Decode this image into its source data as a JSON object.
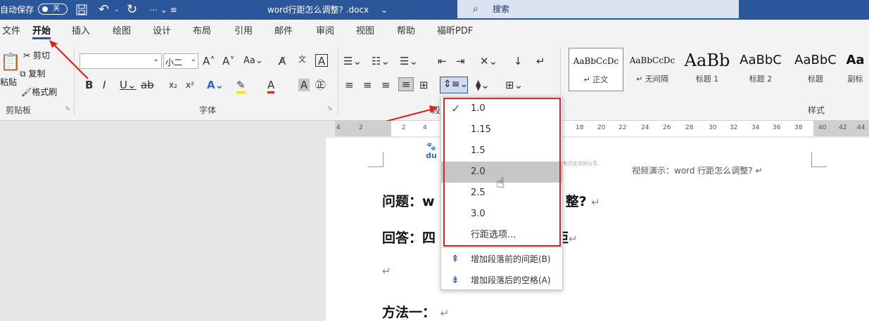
{
  "titlebar": {
    "autosave": "自动保存",
    "toggle": "关",
    "qat_icons": [
      "save-icon",
      "undo-icon",
      "redo-icon",
      "customize-icon"
    ],
    "doc_title": "word行距怎么调整? .docx",
    "search_placeholder": "搜索"
  },
  "tabs": [
    "文件",
    "开始",
    "插入",
    "绘图",
    "设计",
    "布局",
    "引用",
    "邮件",
    "审阅",
    "视图",
    "帮助",
    "福昕PDF"
  ],
  "ribbon": {
    "clipboard": {
      "paste": "粘贴",
      "cut": "剪切",
      "copy": "复制",
      "format_painter": "格式刷",
      "group": "剪贴板"
    },
    "font": {
      "font_name": "",
      "font_size": "小二",
      "group": "字体"
    },
    "paragraph": {
      "group": "段落"
    },
    "styles": {
      "group": "样式",
      "items": [
        {
          "preview": "AaBbCcDc",
          "name": "↵ 正文"
        },
        {
          "preview": "AaBbCcDc",
          "name": "↵ 无间隔"
        },
        {
          "preview": "AaBb",
          "name": "标题 1"
        },
        {
          "preview": "AaBbC",
          "name": "标题 2"
        },
        {
          "preview": "AaBbC",
          "name": "标题"
        },
        {
          "preview": "Aa",
          "name": "副标"
        }
      ]
    }
  },
  "ruler": [
    "4",
    "2",
    "2",
    "4",
    "18",
    "20",
    "22",
    "24",
    "26",
    "28",
    "30",
    "32",
    "34",
    "36",
    "38",
    "40",
    "42",
    "44"
  ],
  "document": {
    "header_text": "视频演示：word 行距怎么调整? ↵",
    "watermark": "偶有历史视频分享。",
    "logo": "du",
    "q_prefix": "问题：w",
    "q_suffix": "整?",
    "a_prefix": "回答：四",
    "a_suffix": "距",
    "empty_mark": "↵",
    "method1": "方法一：",
    "para_mark": "↵"
  },
  "line_spacing_menu": {
    "options": [
      "1.0",
      "1.15",
      "1.5",
      "2.0",
      "2.5",
      "3.0",
      "行距选项..."
    ],
    "checked": "1.0",
    "hovered": "2.0",
    "extra": [
      "增加段落前的间距(B)",
      "增加段落后的空格(A)"
    ]
  }
}
